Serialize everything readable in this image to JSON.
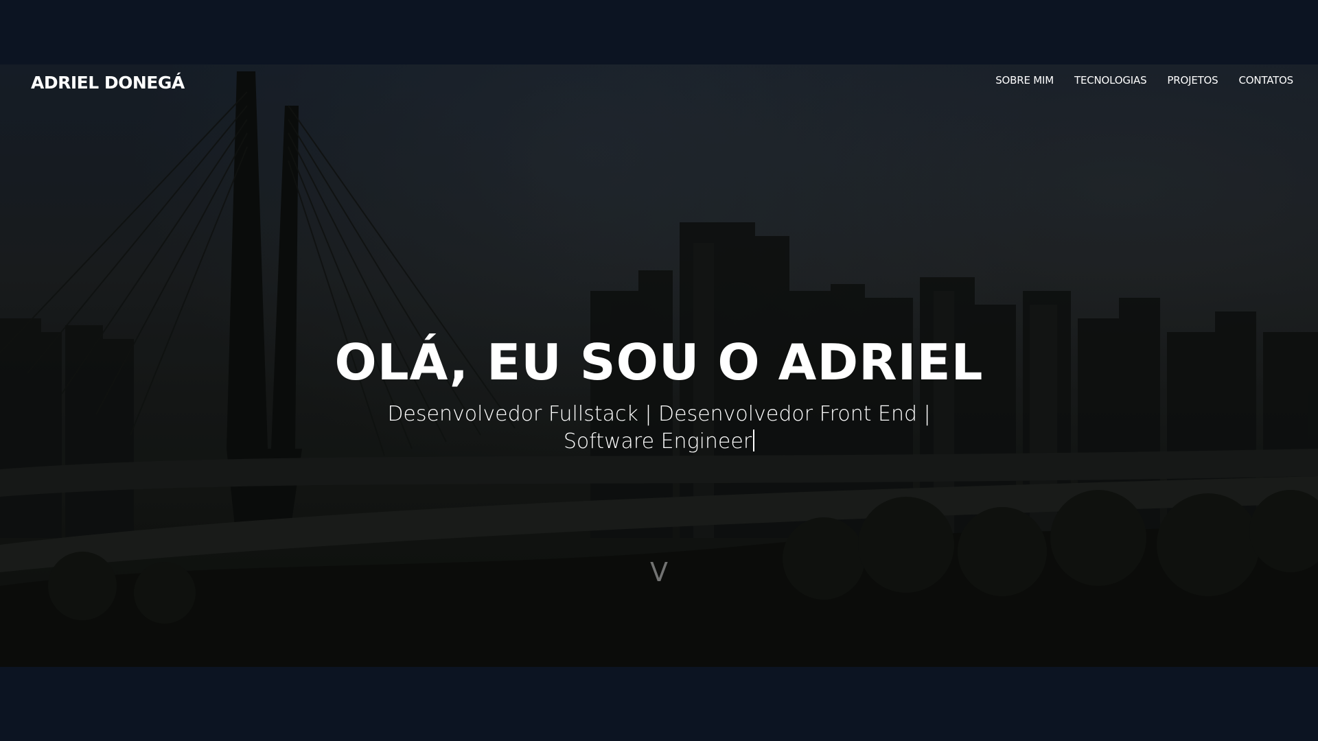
{
  "header": {
    "brand": "ADRIEL DONEGÁ",
    "nav": [
      {
        "label": "SOBRE MIM"
      },
      {
        "label": "TECNOLOGIAS"
      },
      {
        "label": "PROJETOS"
      },
      {
        "label": "CONTATOS"
      }
    ]
  },
  "hero": {
    "title": "OLÁ, EU SOU O ADRIEL",
    "subtitle_line1": "Desenvolvedor Fullstack | Desenvolvedor Front End |",
    "subtitle_line2": "Software Engineer",
    "scroll_icon": "chevron-down-icon",
    "scroll_glyph": "V"
  },
  "colors": {
    "page_background": "#0c1422",
    "text": "#ffffff"
  }
}
